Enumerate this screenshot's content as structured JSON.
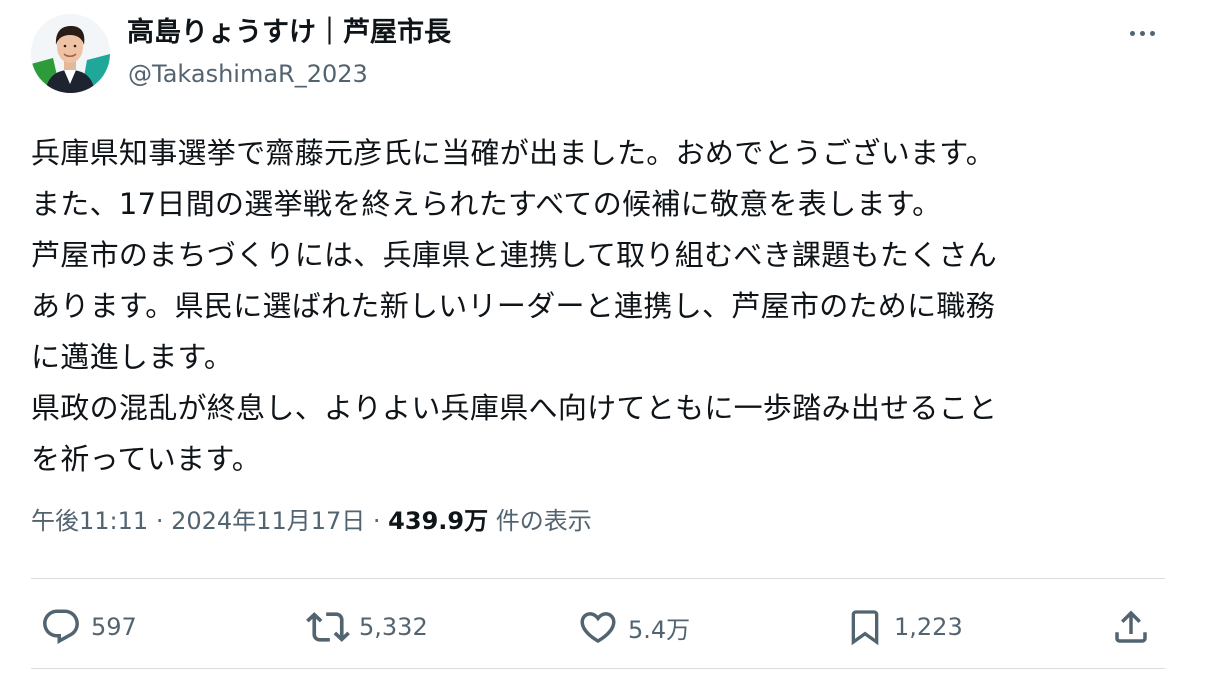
{
  "author": {
    "display_name": "高島りょうすけ｜芦屋市長",
    "handle": "@TakashimaR_2023"
  },
  "post": {
    "lines": [
      "兵庫県知事選挙で齋藤元彦氏に当確が出ました。おめでとうございます。",
      "また、17日間の選挙戦を終えられたすべての候補に敬意を表します。",
      "芦屋市のまちづくりには、兵庫県と連携して取り組むべき課題もたくさん",
      "あります。県民に選ばれた新しいリーダーと連携し、芦屋市のために職務",
      "に邁進します。",
      "県政の混乱が終息し、よりよい兵庫県へ向けてともに一歩踏み出せること",
      "を祈っています。"
    ]
  },
  "meta": {
    "time": "午後11:11",
    "separator": "·",
    "date": "2024年11月17日",
    "views_count": "439.9万",
    "views_label": "件の表示"
  },
  "actions": {
    "replies": "597",
    "reposts": "5,332",
    "likes": "5.4万",
    "bookmarks": "1,223"
  },
  "icons": {
    "more": "more-horizontal-icon",
    "reply": "reply-icon",
    "repost": "repost-icon",
    "like": "heart-icon",
    "bookmark": "bookmark-icon",
    "share": "share-icon"
  },
  "colors": {
    "text": "#0f1419",
    "secondary": "#536471",
    "divider": "#d9dde1",
    "avatar_green": "#2e9b3a",
    "avatar_teal": "#1fa89a"
  }
}
